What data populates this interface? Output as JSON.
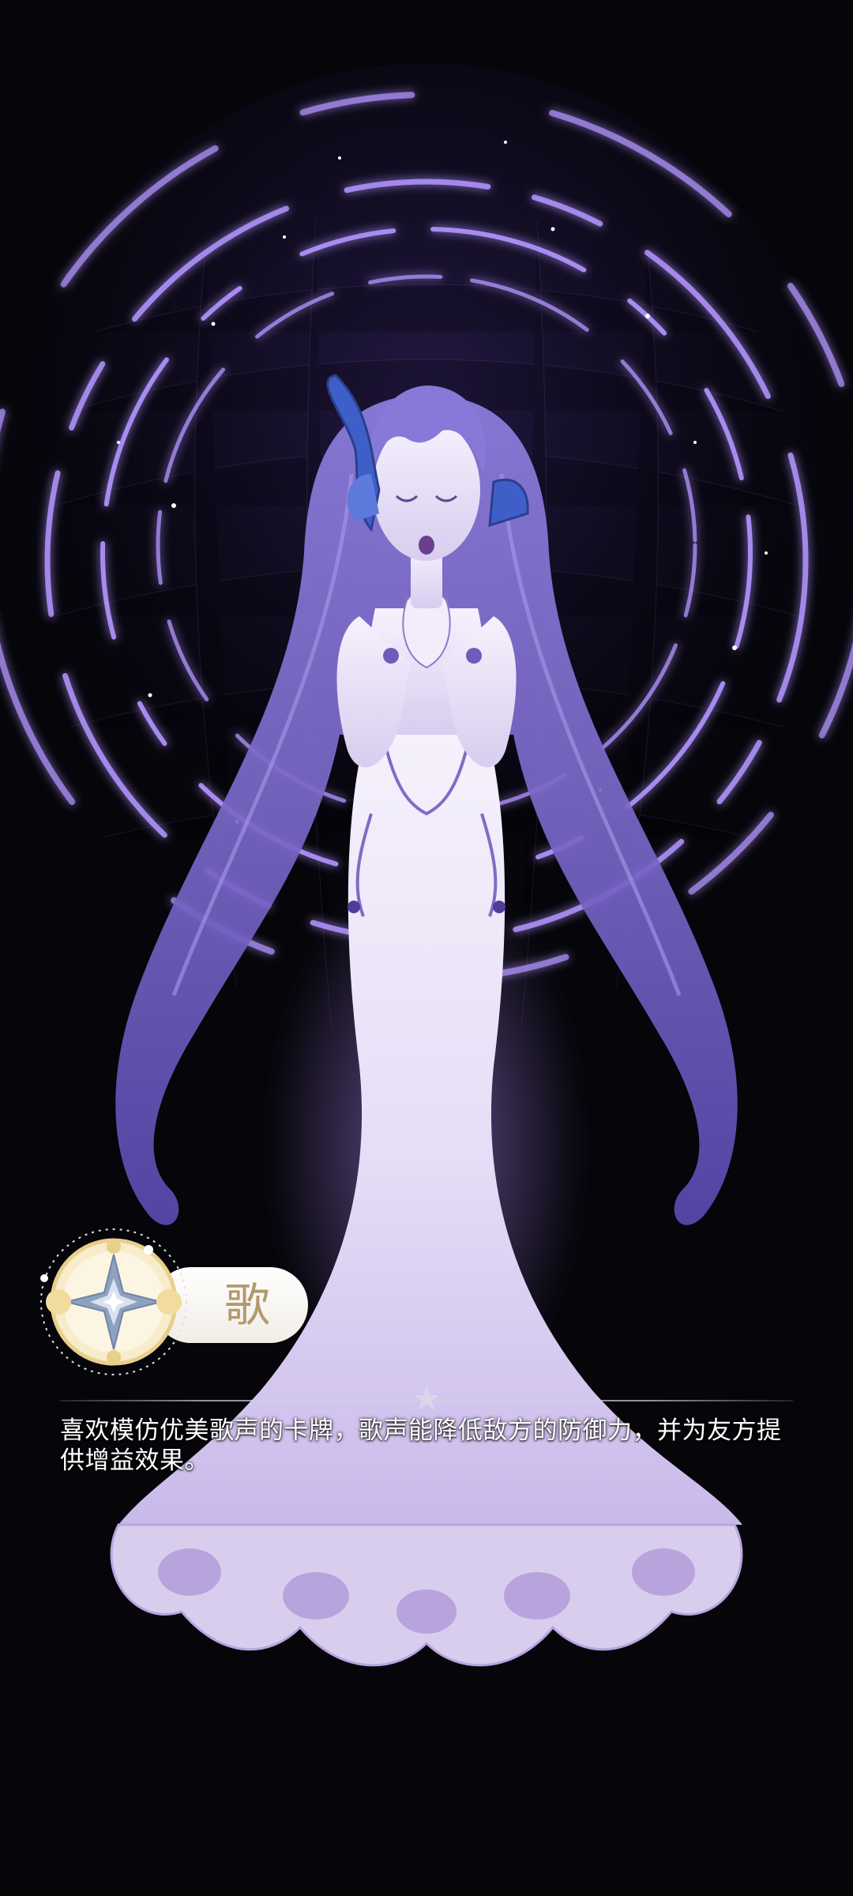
{
  "card": {
    "name": "歌",
    "description": "喜欢模仿优美歌声的卡牌，歌声能降低敌方的防御力，并为友方提供增益效果。"
  },
  "colors": {
    "background": "#05050a",
    "ring_glow": "#9a6dff",
    "hair": "#7a68c8",
    "dress": "#e9e2f6",
    "ornament_blue": "#3f5fc8",
    "badge_gold": "#e8cf8a",
    "badge_text": "#b39a6a"
  },
  "icons": {
    "emblem": "compass-star-emblem-icon",
    "divider": "star-icon"
  }
}
